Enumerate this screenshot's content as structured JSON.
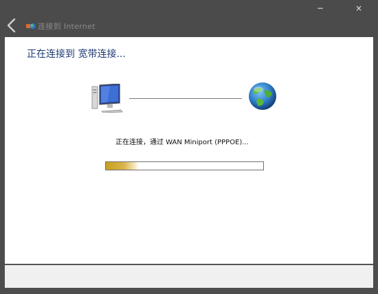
{
  "window": {
    "title": "连接到 Internet",
    "minimize_glyph": "−",
    "close_glyph": "×",
    "back_icon": "back-arrow-icon",
    "app_icon": "network-connection-icon"
  },
  "content": {
    "heading": "正在连接到 宽带连接...",
    "status": "正在连接，通过 WAN Miniport (PPPOE)...",
    "source_icon": "computer-icon",
    "destination_icon": "globe-icon",
    "progress_fraction": 0.21,
    "progress_color": "#c9a021"
  }
}
